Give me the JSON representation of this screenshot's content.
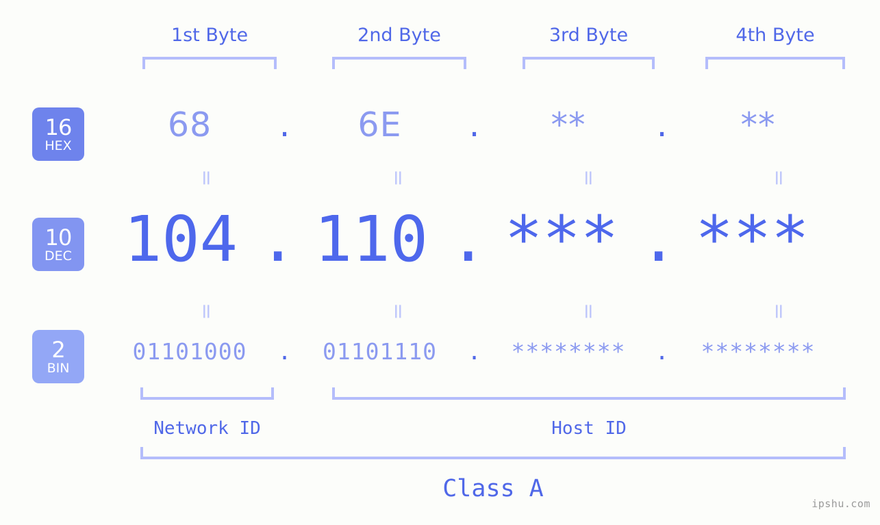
{
  "background_color": "#fcfdfa",
  "colors": {
    "accent_strong": "#4e68ec",
    "accent_mid": "#5068e8",
    "accent_light": "#8b9af0",
    "bracket": "#b4bdfb",
    "equals": "#c0c8fb",
    "watermark": "#9a9a9a",
    "badge_hex": "#6e83ec",
    "badge_dec": "#8295f1",
    "badge_bin": "#93a7f6"
  },
  "byte_headers": [
    {
      "label": "1st Byte"
    },
    {
      "label": "2nd Byte"
    },
    {
      "label": "3rd Byte"
    },
    {
      "label": "4th Byte"
    }
  ],
  "bases": [
    {
      "number": "16",
      "name": "HEX"
    },
    {
      "number": "10",
      "name": "DEC"
    },
    {
      "number": "2",
      "name": "BIN"
    }
  ],
  "rows": {
    "hex": {
      "base_number": "16",
      "base_name": "HEX",
      "separator": ".",
      "bytes": [
        "68",
        "6E",
        "**",
        "**"
      ]
    },
    "dec": {
      "base_number": "10",
      "base_name": "DEC",
      "separator": ".",
      "bytes": [
        "104",
        "110",
        "***",
        "***"
      ]
    },
    "bin": {
      "base_number": "2",
      "base_name": "BIN",
      "separator": ".",
      "bytes": [
        "01101000",
        "01101110",
        "********",
        "********"
      ]
    }
  },
  "equality_marks": {
    "glyph": "=",
    "count_per_row": 4,
    "rows": 2
  },
  "sections": {
    "network_id": "Network ID",
    "host_id": "Host ID",
    "class": "Class A"
  },
  "watermark": "ipshu.com"
}
